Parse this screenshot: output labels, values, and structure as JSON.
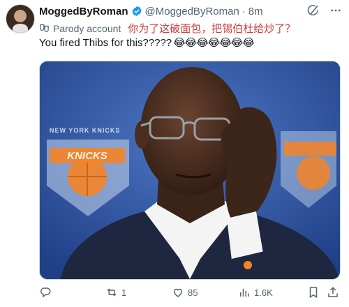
{
  "tweet": {
    "display_name": "MoggedByRoman",
    "handle": "@MoggedByRoman",
    "separator": "·",
    "timestamp": "8m",
    "parody_label": "Parody account",
    "annotation_text": "你为了这破面包，把锡伯杜给炒了？",
    "body_text": "You fired Thibs for this?????",
    "body_emojis": "😂😂😂😂😂😂😂",
    "image_text": "NEW YORK KNICKS"
  },
  "actions": {
    "replies": "",
    "retweets": "1",
    "likes": "85",
    "views": "1.6K"
  },
  "icons": [
    "avatar",
    "verified-badge-icon",
    "grok-icon",
    "more-icon",
    "parody-mask-icon",
    "reply-icon",
    "retweet-icon",
    "like-icon",
    "views-icon",
    "bookmark-icon",
    "share-icon"
  ],
  "colors": {
    "verified_blue": "#1d9bf0",
    "annotation_red": "#d23b3b",
    "knicks_orange": "#f58426",
    "knicks_blue": "#006bb6"
  }
}
